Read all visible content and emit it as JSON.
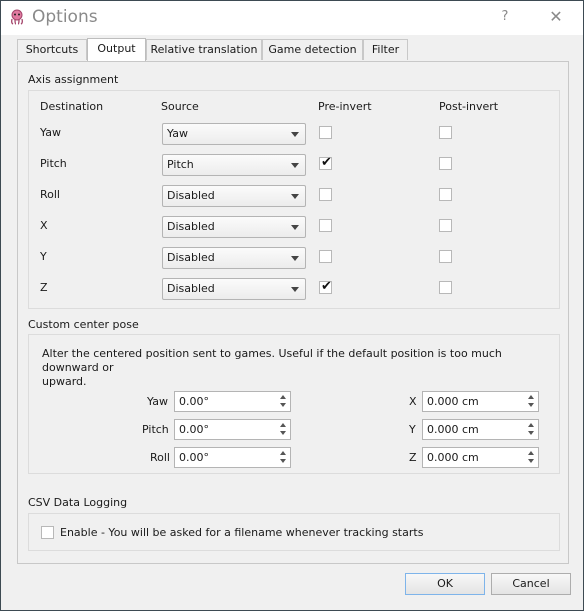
{
  "window": {
    "title": "Options",
    "help_glyph": "?",
    "close_glyph": "✕",
    "icon": "octopus-app-icon"
  },
  "tabs": [
    {
      "label": "Shortcuts",
      "active": false
    },
    {
      "label": "Output",
      "active": true
    },
    {
      "label": "Relative translation",
      "active": false
    },
    {
      "label": "Game detection",
      "active": false
    },
    {
      "label": "Filter",
      "active": false
    }
  ],
  "axis_assignment": {
    "title": "Axis assignment",
    "headers": {
      "destination": "Destination",
      "source": "Source",
      "pre_invert": "Pre-invert",
      "post_invert": "Post-invert"
    },
    "rows": [
      {
        "destination": "Yaw",
        "source": "Yaw",
        "pre_invert": false,
        "post_invert": false
      },
      {
        "destination": "Pitch",
        "source": "Pitch",
        "pre_invert": true,
        "post_invert": false
      },
      {
        "destination": "Roll",
        "source": "Disabled",
        "pre_invert": false,
        "post_invert": false
      },
      {
        "destination": "X",
        "source": "Disabled",
        "pre_invert": false,
        "post_invert": false
      },
      {
        "destination": "Y",
        "source": "Disabled",
        "pre_invert": false,
        "post_invert": false
      },
      {
        "destination": "Z",
        "source": "Disabled",
        "pre_invert": true,
        "post_invert": false
      }
    ]
  },
  "center_pose": {
    "title": "Custom center pose",
    "description_line1": "Alter the centered position sent to games. Useful if the default position is too much downward or",
    "description_line2": "upward.",
    "rotation": [
      {
        "label": "Yaw",
        "value": "0.00°"
      },
      {
        "label": "Pitch",
        "value": "0.00°"
      },
      {
        "label": "Roll",
        "value": "0.00°"
      }
    ],
    "translation": [
      {
        "label": "X",
        "value": "0.000 cm"
      },
      {
        "label": "Y",
        "value": "0.000 cm"
      },
      {
        "label": "Z",
        "value": "0.000 cm"
      }
    ]
  },
  "csv_logging": {
    "title": "CSV Data Logging",
    "enable_label": "Enable - You will be asked for a filename whenever tracking starts",
    "enabled": false
  },
  "buttons": {
    "ok": "OK",
    "cancel": "Cancel"
  },
  "tick_glyph": "✔"
}
